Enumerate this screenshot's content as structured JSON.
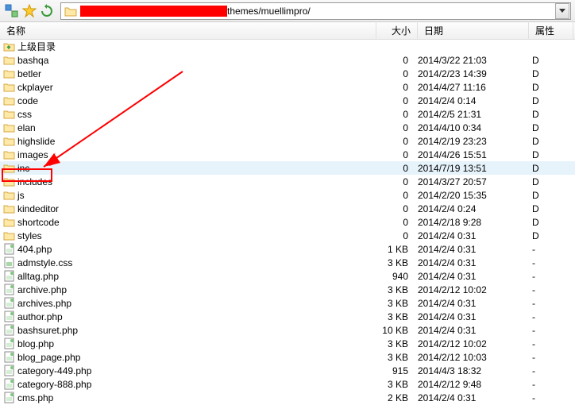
{
  "toolbar": {
    "path": "themes/muellimpro/"
  },
  "columns": {
    "name": "名称",
    "size": "大小",
    "date": "日期",
    "attr": "属性"
  },
  "parent_dir_label": "上级目录",
  "highlighted_index": 9,
  "rows": [
    {
      "type": "folder",
      "name": "bashqa",
      "size": "0",
      "date": "2014/3/22 21:03",
      "attr": "D"
    },
    {
      "type": "folder",
      "name": "betler",
      "size": "0",
      "date": "2014/2/23 14:39",
      "attr": "D"
    },
    {
      "type": "folder",
      "name": "ckplayer",
      "size": "0",
      "date": "2014/4/27 11:16",
      "attr": "D"
    },
    {
      "type": "folder",
      "name": "code",
      "size": "0",
      "date": "2014/2/4 0:14",
      "attr": "D"
    },
    {
      "type": "folder",
      "name": "css",
      "size": "0",
      "date": "2014/2/5 21:31",
      "attr": "D"
    },
    {
      "type": "folder",
      "name": "elan",
      "size": "0",
      "date": "2014/4/10 0:34",
      "attr": "D"
    },
    {
      "type": "folder",
      "name": "highslide",
      "size": "0",
      "date": "2014/2/19 23:23",
      "attr": "D"
    },
    {
      "type": "folder",
      "name": "images",
      "size": "0",
      "date": "2014/4/26 15:51",
      "attr": "D"
    },
    {
      "type": "folder",
      "name": "inc",
      "size": "0",
      "date": "2014/7/19 13:51",
      "attr": "D"
    },
    {
      "type": "folder",
      "name": "includes",
      "size": "0",
      "date": "2014/3/27 20:57",
      "attr": "D"
    },
    {
      "type": "folder",
      "name": "js",
      "size": "0",
      "date": "2014/2/20 15:35",
      "attr": "D"
    },
    {
      "type": "folder",
      "name": "kindeditor",
      "size": "0",
      "date": "2014/2/4 0:24",
      "attr": "D"
    },
    {
      "type": "folder",
      "name": "shortcode",
      "size": "0",
      "date": "2014/2/18 9:28",
      "attr": "D"
    },
    {
      "type": "folder",
      "name": "styles",
      "size": "0",
      "date": "2014/2/4 0:31",
      "attr": "D"
    },
    {
      "type": "php",
      "name": "404.php",
      "size": "1 KB",
      "date": "2014/2/4 0:31",
      "attr": "-"
    },
    {
      "type": "css",
      "name": "admstyle.css",
      "size": "3 KB",
      "date": "2014/2/4 0:31",
      "attr": "-"
    },
    {
      "type": "php",
      "name": "alltag.php",
      "size": "940",
      "date": "2014/2/4 0:31",
      "attr": "-"
    },
    {
      "type": "php",
      "name": "archive.php",
      "size": "3 KB",
      "date": "2014/2/12 10:02",
      "attr": "-"
    },
    {
      "type": "php",
      "name": "archives.php",
      "size": "3 KB",
      "date": "2014/2/4 0:31",
      "attr": "-"
    },
    {
      "type": "php",
      "name": "author.php",
      "size": "3 KB",
      "date": "2014/2/4 0:31",
      "attr": "-"
    },
    {
      "type": "php",
      "name": "bashsuret.php",
      "size": "10 KB",
      "date": "2014/2/4 0:31",
      "attr": "-"
    },
    {
      "type": "php",
      "name": "blog.php",
      "size": "3 KB",
      "date": "2014/2/12 10:02",
      "attr": "-"
    },
    {
      "type": "php",
      "name": "blog_page.php",
      "size": "3 KB",
      "date": "2014/2/12 10:03",
      "attr": "-"
    },
    {
      "type": "php",
      "name": "category-449.php",
      "size": "915",
      "date": "2014/4/3 18:32",
      "attr": "-"
    },
    {
      "type": "php",
      "name": "category-888.php",
      "size": "3 KB",
      "date": "2014/2/12 9:48",
      "attr": "-"
    },
    {
      "type": "php",
      "name": "cms.php",
      "size": "2 KB",
      "date": "2014/2/4 0:31",
      "attr": "-"
    }
  ]
}
